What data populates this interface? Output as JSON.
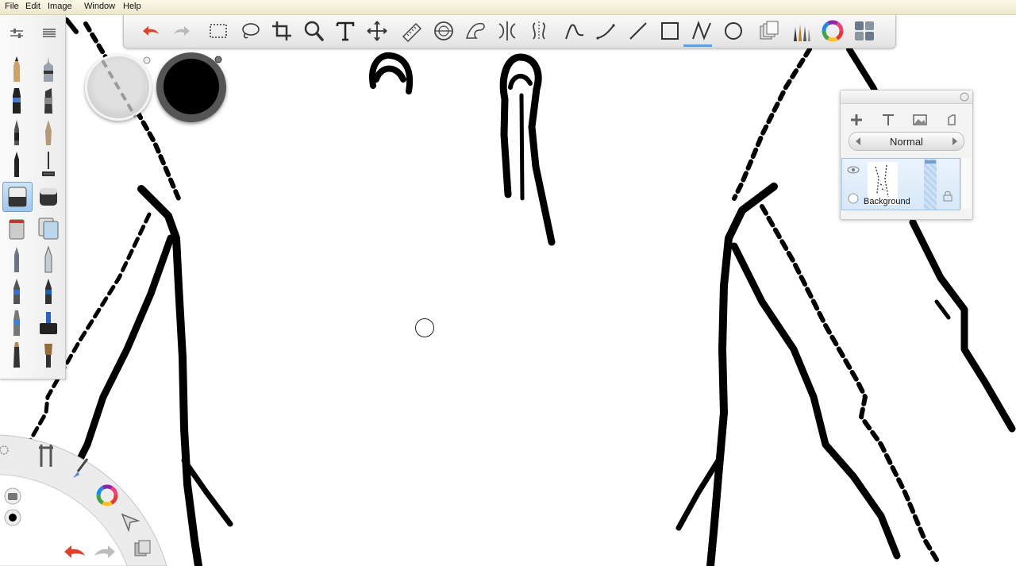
{
  "menu": {
    "items": [
      "File",
      "Edit",
      "Image",
      "Window",
      "Help"
    ]
  },
  "toolbar": {
    "tools": [
      "undo-icon",
      "redo-icon",
      "rect-select-icon",
      "lasso-icon",
      "crop-icon",
      "magnify-icon",
      "text-icon",
      "move-icon",
      "ruler-icon",
      "ellipse-guide-icon",
      "french-curve-icon",
      "symmetry-icon",
      "symmetry-vertical-icon",
      "freehand-stroke-icon",
      "curve-stroke-icon",
      "line-icon",
      "rectangle-icon",
      "polyline-icon",
      "ellipse-icon",
      "copic-library-icon",
      "brush-library-icon",
      "color-wheel-icon",
      "palette-grid-icon"
    ],
    "selected": "freehand-stroke-icon"
  },
  "colors": {
    "accent": "#5aa0e6",
    "undo": "#e0412a",
    "brush_color": "#000000",
    "secondary_color": "#cfcfcf"
  },
  "layers": {
    "blend_mode": "Normal",
    "layer_name": "Background"
  }
}
